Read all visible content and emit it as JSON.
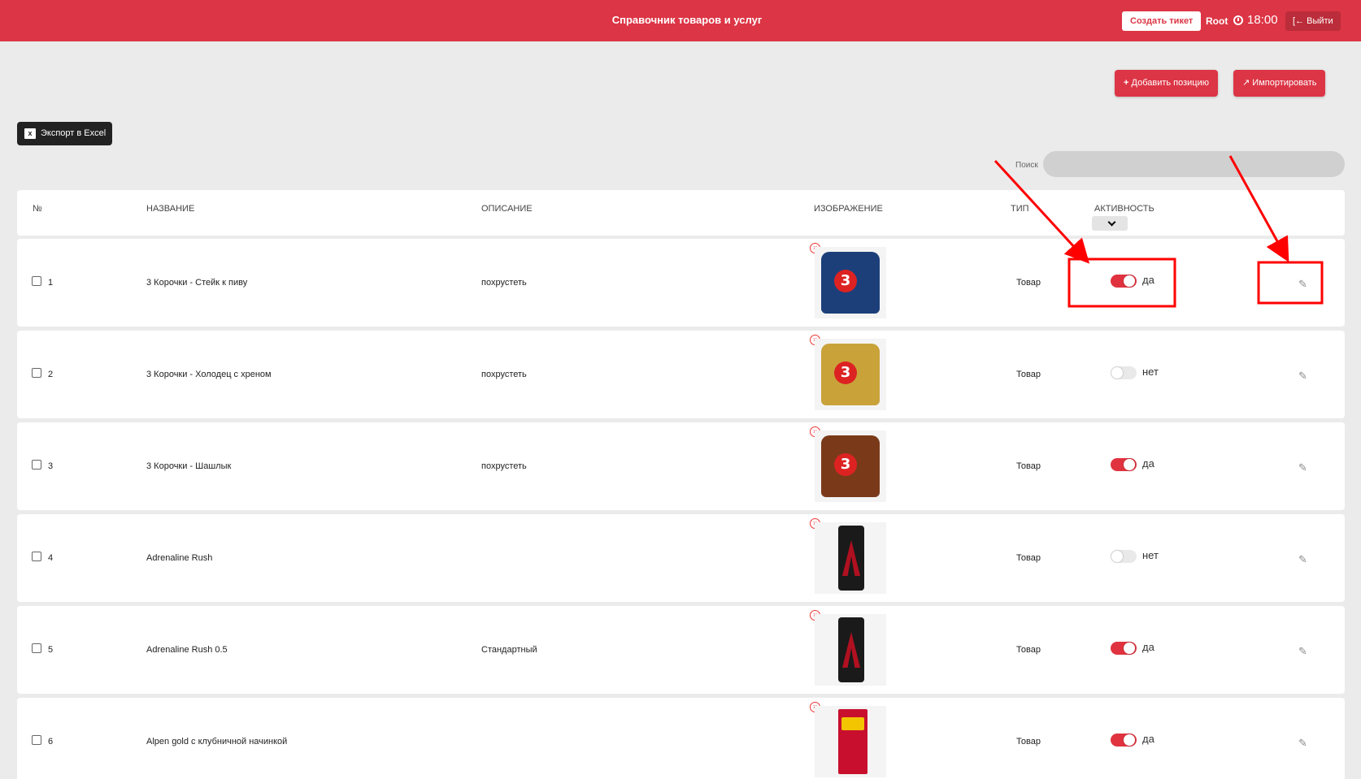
{
  "header": {
    "title": "Справочник товаров и услуг",
    "ticket_button": "Создать тикет",
    "user": "Root",
    "time": "18:00",
    "logout": "Выйти",
    "colors": {
      "brand": "#dc3545"
    }
  },
  "toolbar": {
    "add_label": "Добавить позицию",
    "import_label": "Импортировать",
    "export_label": "Экспорт в Excel",
    "excel_icon_letter": "x"
  },
  "search": {
    "label": "Поиск",
    "value": ""
  },
  "table": {
    "columns": {
      "num": "№",
      "name": "НАЗВАНИЕ",
      "description": "ОПИСАНИЕ",
      "image": "ИЗОБРАЖЕНИЕ",
      "type": "ТИП",
      "activity": "АКТИВНОСТЬ"
    },
    "rows": [
      {
        "num": "1",
        "name": "3 Корочки - Стейк к пиву",
        "description": "похрустеть",
        "type": "Товар",
        "active": true,
        "active_label": "да",
        "image_kind": "bag-blue"
      },
      {
        "num": "2",
        "name": "3 Корочки - Холодец с хреном",
        "description": "похрустеть",
        "type": "Товар",
        "active": false,
        "active_label": "нет",
        "image_kind": "bag-gold"
      },
      {
        "num": "3",
        "name": "3 Корочки - Шашлык",
        "description": "похрустеть",
        "type": "Товар",
        "active": true,
        "active_label": "да",
        "image_kind": "bag-brown"
      },
      {
        "num": "4",
        "name": "Adrenaline Rush",
        "description": "",
        "type": "Товар",
        "active": false,
        "active_label": "нет",
        "image_kind": "can"
      },
      {
        "num": "5",
        "name": "Adrenaline Rush 0.5",
        "description": "Стандартный",
        "type": "Товар",
        "active": true,
        "active_label": "да",
        "image_kind": "can"
      },
      {
        "num": "6",
        "name": "Alpen gold с клубничной начинкой",
        "description": "",
        "type": "Товар",
        "active": true,
        "active_label": "да",
        "image_kind": "chocolate"
      }
    ]
  },
  "icons": {
    "plus": "plus-icon",
    "import": "external-link-icon",
    "excel": "excel-icon",
    "clock": "clock-icon",
    "logout": "sign-out-icon",
    "delete": "circle-x-icon",
    "edit": "pencil-icon"
  },
  "accent_colors": {
    "toggle_on": "#e0333f",
    "annotation": "#ff0000"
  }
}
